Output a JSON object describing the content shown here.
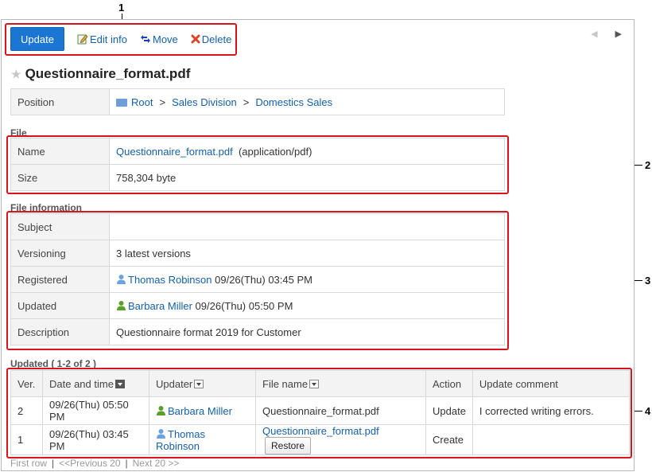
{
  "callouts": [
    "1",
    "2",
    "3",
    "4"
  ],
  "toolbar": {
    "update_label": "Update",
    "edit_info_label": "Edit info",
    "move_label": "Move",
    "delete_label": "Delete"
  },
  "file_title": "Questionnaire_format.pdf",
  "position": {
    "label": "Position",
    "path": [
      "Root",
      "Sales Division",
      "Domestics Sales"
    ],
    "separator": ">"
  },
  "file_section": {
    "heading": "File",
    "name_label": "Name",
    "name_value": "Questionnaire_format.pdf",
    "mime": "(application/pdf)",
    "size_label": "Size",
    "size_value": "758,304 byte"
  },
  "info_section": {
    "heading": "File information",
    "subject_label": "Subject",
    "subject_value": "",
    "versioning_label": "Versioning",
    "versioning_value": "3  latest versions",
    "registered_label": "Registered",
    "registered_user": "Thomas Robinson",
    "registered_time": "09/26(Thu) 03:45 PM",
    "updated_label": "Updated",
    "updated_user": "Barbara Miller",
    "updated_time": "09/26(Thu) 05:50 PM",
    "description_label": "Description",
    "description_value": "Questionnaire format 2019 for Customer"
  },
  "history": {
    "heading": "Updated ( 1-2 of 2 )",
    "columns": [
      "Ver.",
      "Date and time",
      "Updater",
      "File name",
      "Action",
      "Update comment"
    ],
    "rows": [
      {
        "ver": "2",
        "datetime": "09/26(Thu) 05:50 PM",
        "updater": "Barbara Miller",
        "file": "Questionnaire_format.pdf",
        "action": "Update",
        "comment": "I corrected writing errors."
      },
      {
        "ver": "1",
        "datetime": "09/26(Thu) 03:45 PM",
        "updater": "Thomas Robinson",
        "file": "Questionnaire_format.pdf",
        "restore": "Restore",
        "action": "Create",
        "comment": ""
      }
    ]
  },
  "pager": {
    "first": "First row",
    "prev": "<<Previous 20",
    "next": "Next 20 >>",
    "separator": "|"
  },
  "colors": {
    "accent": "#1a76d2",
    "link": "#1560a8",
    "highlight": "#d8141c",
    "delete_icon": "#d8452a",
    "user_male": "#6aa3e0",
    "user_female": "#5a9f2a"
  }
}
